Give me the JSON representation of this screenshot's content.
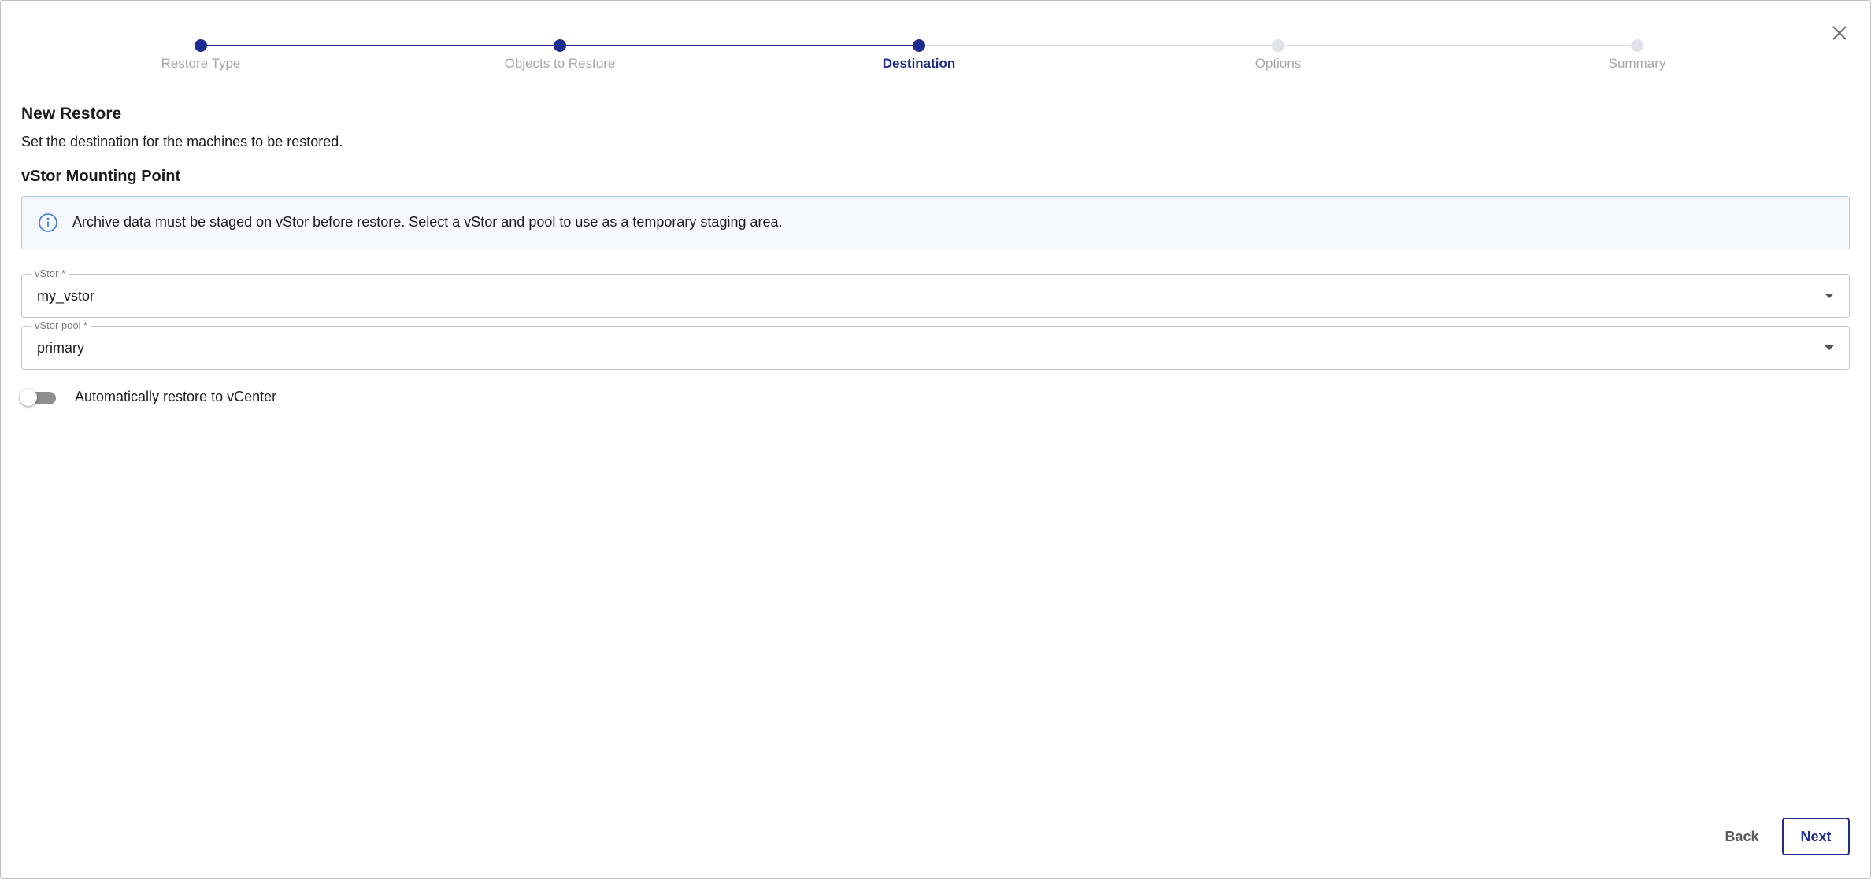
{
  "stepper": {
    "steps": [
      {
        "label": "Restore Type",
        "state": "done"
      },
      {
        "label": "Objects to Restore",
        "state": "done"
      },
      {
        "label": "Destination",
        "state": "active"
      },
      {
        "label": "Options",
        "state": "todo"
      },
      {
        "label": "Summary",
        "state": "todo"
      }
    ]
  },
  "header": {
    "title": "New Restore",
    "subtitle": "Set the destination for the machines to be restored."
  },
  "section": {
    "title": "vStor Mounting Point"
  },
  "info": {
    "icon": "info-icon",
    "text": "Archive data must be staged on vStor before restore. Select a vStor and pool to use as a temporary staging area."
  },
  "fields": {
    "vstor": {
      "label": "vStor *",
      "value": "my_vstor"
    },
    "pool": {
      "label": "vStor pool *",
      "value": "primary"
    }
  },
  "toggle": {
    "label": "Automatically restore to vCenter",
    "checked": false
  },
  "footer": {
    "back_label": "Back",
    "next_label": "Next"
  },
  "colors": {
    "accent": "#1f2c8f",
    "inactive": "#dfe2e8",
    "info_border": "#a9c4ee",
    "info_bg": "#f5f8fd"
  }
}
